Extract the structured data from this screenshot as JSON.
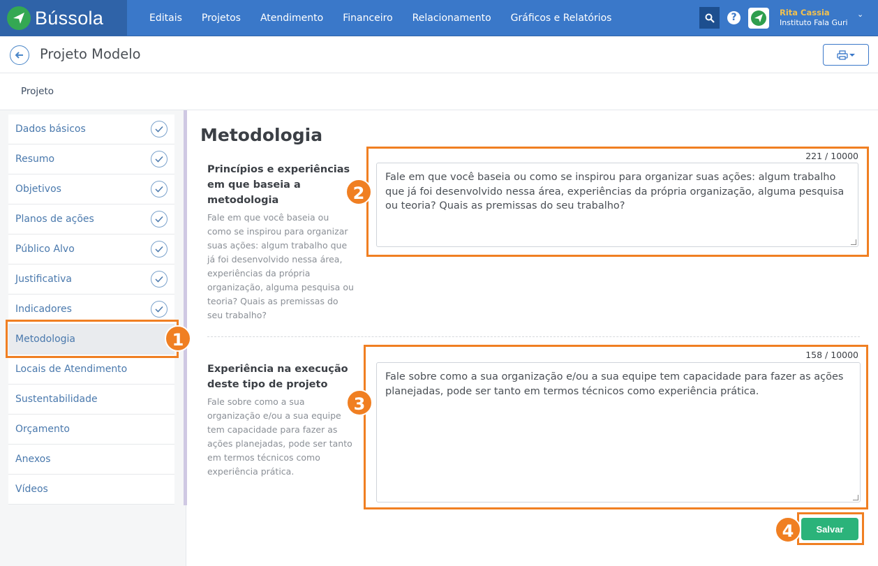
{
  "header": {
    "logo_text": "Bússola",
    "nav": [
      "Editais",
      "Projetos",
      "Atendimento",
      "Financeiro",
      "Relacionamento",
      "Gráficos e Relatórios"
    ],
    "user_name": "Rita Cassia",
    "user_org": "Instituto Fala Guri",
    "help_glyph": "?"
  },
  "title_bar": {
    "page_title": "Projeto Modelo"
  },
  "tabs": {
    "active": "Projeto"
  },
  "sidebar": {
    "items": [
      {
        "label": "Dados básicos",
        "done": true
      },
      {
        "label": "Resumo",
        "done": true
      },
      {
        "label": "Objetivos",
        "done": true
      },
      {
        "label": "Planos de ações",
        "done": true
      },
      {
        "label": "Público Alvo",
        "done": true
      },
      {
        "label": "Justificativa",
        "done": true
      },
      {
        "label": "Indicadores",
        "done": true
      },
      {
        "label": "Metodologia",
        "done": false,
        "active": true
      },
      {
        "label": "Locais de Atendimento",
        "done": false
      },
      {
        "label": "Sustentabilidade",
        "done": false
      },
      {
        "label": "Orçamento",
        "done": false
      },
      {
        "label": "Anexos",
        "done": false
      },
      {
        "label": "Vídeos",
        "done": false
      }
    ]
  },
  "main": {
    "section_title": "Metodologia",
    "fields": [
      {
        "label": "Princípios e experiências em que baseia a metodologia",
        "help": "Fale em que você baseia ou como se inspirou para organizar suas ações: algum trabalho que já foi desenvolvido nessa área, experiências da própria organização, alguma pesquisa ou teoria? Quais as premissas do seu trabalho?",
        "counter": "221 / 10000",
        "value": "Fale em que você baseia ou como se inspirou para organizar suas ações: algum trabalho que já foi desenvolvido nessa área, experiências da própria organização, alguma pesquisa ou teoria? Quais as premissas do seu trabalho?"
      },
      {
        "label": "Experiência na execução deste tipo de projeto",
        "help": "Fale sobre como a sua organização e/ou a sua equipe tem capacidade para fazer as ações planejadas, pode ser tanto em termos técnicos como experiência prática.",
        "counter": "158 / 10000",
        "value": "Fale sobre como a sua organização e/ou a sua equipe tem capacidade para fazer as ações planejadas, pode ser tanto em termos técnicos como experiência prática."
      }
    ],
    "save_label": "Salvar"
  },
  "annotations": {
    "badges": [
      "1",
      "2",
      "3",
      "4"
    ],
    "color": "#f07f22"
  },
  "colors": {
    "topbar": "#3a78c9",
    "accent": "#4a79ad",
    "save": "#2bb37a"
  }
}
